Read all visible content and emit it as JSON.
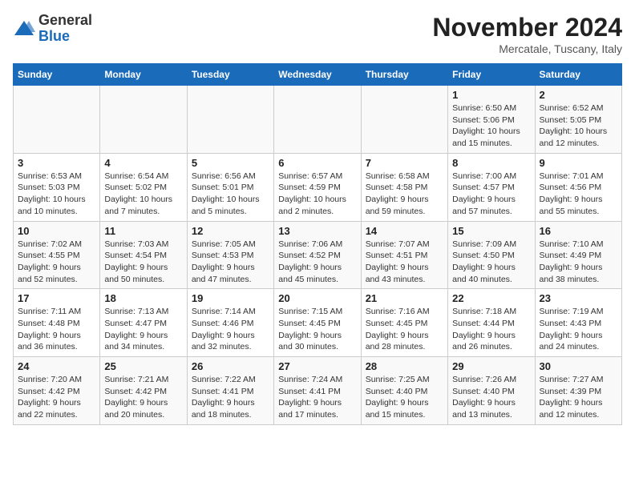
{
  "header": {
    "logo_general": "General",
    "logo_blue": "Blue",
    "month_title": "November 2024",
    "location": "Mercatale, Tuscany, Italy"
  },
  "columns": [
    "Sunday",
    "Monday",
    "Tuesday",
    "Wednesday",
    "Thursday",
    "Friday",
    "Saturday"
  ],
  "weeks": [
    [
      {
        "day": "",
        "info": ""
      },
      {
        "day": "",
        "info": ""
      },
      {
        "day": "",
        "info": ""
      },
      {
        "day": "",
        "info": ""
      },
      {
        "day": "",
        "info": ""
      },
      {
        "day": "1",
        "info": "Sunrise: 6:50 AM\nSunset: 5:06 PM\nDaylight: 10 hours\nand 15 minutes."
      },
      {
        "day": "2",
        "info": "Sunrise: 6:52 AM\nSunset: 5:05 PM\nDaylight: 10 hours\nand 12 minutes."
      }
    ],
    [
      {
        "day": "3",
        "info": "Sunrise: 6:53 AM\nSunset: 5:03 PM\nDaylight: 10 hours\nand 10 minutes."
      },
      {
        "day": "4",
        "info": "Sunrise: 6:54 AM\nSunset: 5:02 PM\nDaylight: 10 hours\nand 7 minutes."
      },
      {
        "day": "5",
        "info": "Sunrise: 6:56 AM\nSunset: 5:01 PM\nDaylight: 10 hours\nand 5 minutes."
      },
      {
        "day": "6",
        "info": "Sunrise: 6:57 AM\nSunset: 4:59 PM\nDaylight: 10 hours\nand 2 minutes."
      },
      {
        "day": "7",
        "info": "Sunrise: 6:58 AM\nSunset: 4:58 PM\nDaylight: 9 hours\nand 59 minutes."
      },
      {
        "day": "8",
        "info": "Sunrise: 7:00 AM\nSunset: 4:57 PM\nDaylight: 9 hours\nand 57 minutes."
      },
      {
        "day": "9",
        "info": "Sunrise: 7:01 AM\nSunset: 4:56 PM\nDaylight: 9 hours\nand 55 minutes."
      }
    ],
    [
      {
        "day": "10",
        "info": "Sunrise: 7:02 AM\nSunset: 4:55 PM\nDaylight: 9 hours\nand 52 minutes."
      },
      {
        "day": "11",
        "info": "Sunrise: 7:03 AM\nSunset: 4:54 PM\nDaylight: 9 hours\nand 50 minutes."
      },
      {
        "day": "12",
        "info": "Sunrise: 7:05 AM\nSunset: 4:53 PM\nDaylight: 9 hours\nand 47 minutes."
      },
      {
        "day": "13",
        "info": "Sunrise: 7:06 AM\nSunset: 4:52 PM\nDaylight: 9 hours\nand 45 minutes."
      },
      {
        "day": "14",
        "info": "Sunrise: 7:07 AM\nSunset: 4:51 PM\nDaylight: 9 hours\nand 43 minutes."
      },
      {
        "day": "15",
        "info": "Sunrise: 7:09 AM\nSunset: 4:50 PM\nDaylight: 9 hours\nand 40 minutes."
      },
      {
        "day": "16",
        "info": "Sunrise: 7:10 AM\nSunset: 4:49 PM\nDaylight: 9 hours\nand 38 minutes."
      }
    ],
    [
      {
        "day": "17",
        "info": "Sunrise: 7:11 AM\nSunset: 4:48 PM\nDaylight: 9 hours\nand 36 minutes."
      },
      {
        "day": "18",
        "info": "Sunrise: 7:13 AM\nSunset: 4:47 PM\nDaylight: 9 hours\nand 34 minutes."
      },
      {
        "day": "19",
        "info": "Sunrise: 7:14 AM\nSunset: 4:46 PM\nDaylight: 9 hours\nand 32 minutes."
      },
      {
        "day": "20",
        "info": "Sunrise: 7:15 AM\nSunset: 4:45 PM\nDaylight: 9 hours\nand 30 minutes."
      },
      {
        "day": "21",
        "info": "Sunrise: 7:16 AM\nSunset: 4:45 PM\nDaylight: 9 hours\nand 28 minutes."
      },
      {
        "day": "22",
        "info": "Sunrise: 7:18 AM\nSunset: 4:44 PM\nDaylight: 9 hours\nand 26 minutes."
      },
      {
        "day": "23",
        "info": "Sunrise: 7:19 AM\nSunset: 4:43 PM\nDaylight: 9 hours\nand 24 minutes."
      }
    ],
    [
      {
        "day": "24",
        "info": "Sunrise: 7:20 AM\nSunset: 4:42 PM\nDaylight: 9 hours\nand 22 minutes."
      },
      {
        "day": "25",
        "info": "Sunrise: 7:21 AM\nSunset: 4:42 PM\nDaylight: 9 hours\nand 20 minutes."
      },
      {
        "day": "26",
        "info": "Sunrise: 7:22 AM\nSunset: 4:41 PM\nDaylight: 9 hours\nand 18 minutes."
      },
      {
        "day": "27",
        "info": "Sunrise: 7:24 AM\nSunset: 4:41 PM\nDaylight: 9 hours\nand 17 minutes."
      },
      {
        "day": "28",
        "info": "Sunrise: 7:25 AM\nSunset: 4:40 PM\nDaylight: 9 hours\nand 15 minutes."
      },
      {
        "day": "29",
        "info": "Sunrise: 7:26 AM\nSunset: 4:40 PM\nDaylight: 9 hours\nand 13 minutes."
      },
      {
        "day": "30",
        "info": "Sunrise: 7:27 AM\nSunset: 4:39 PM\nDaylight: 9 hours\nand 12 minutes."
      }
    ]
  ]
}
